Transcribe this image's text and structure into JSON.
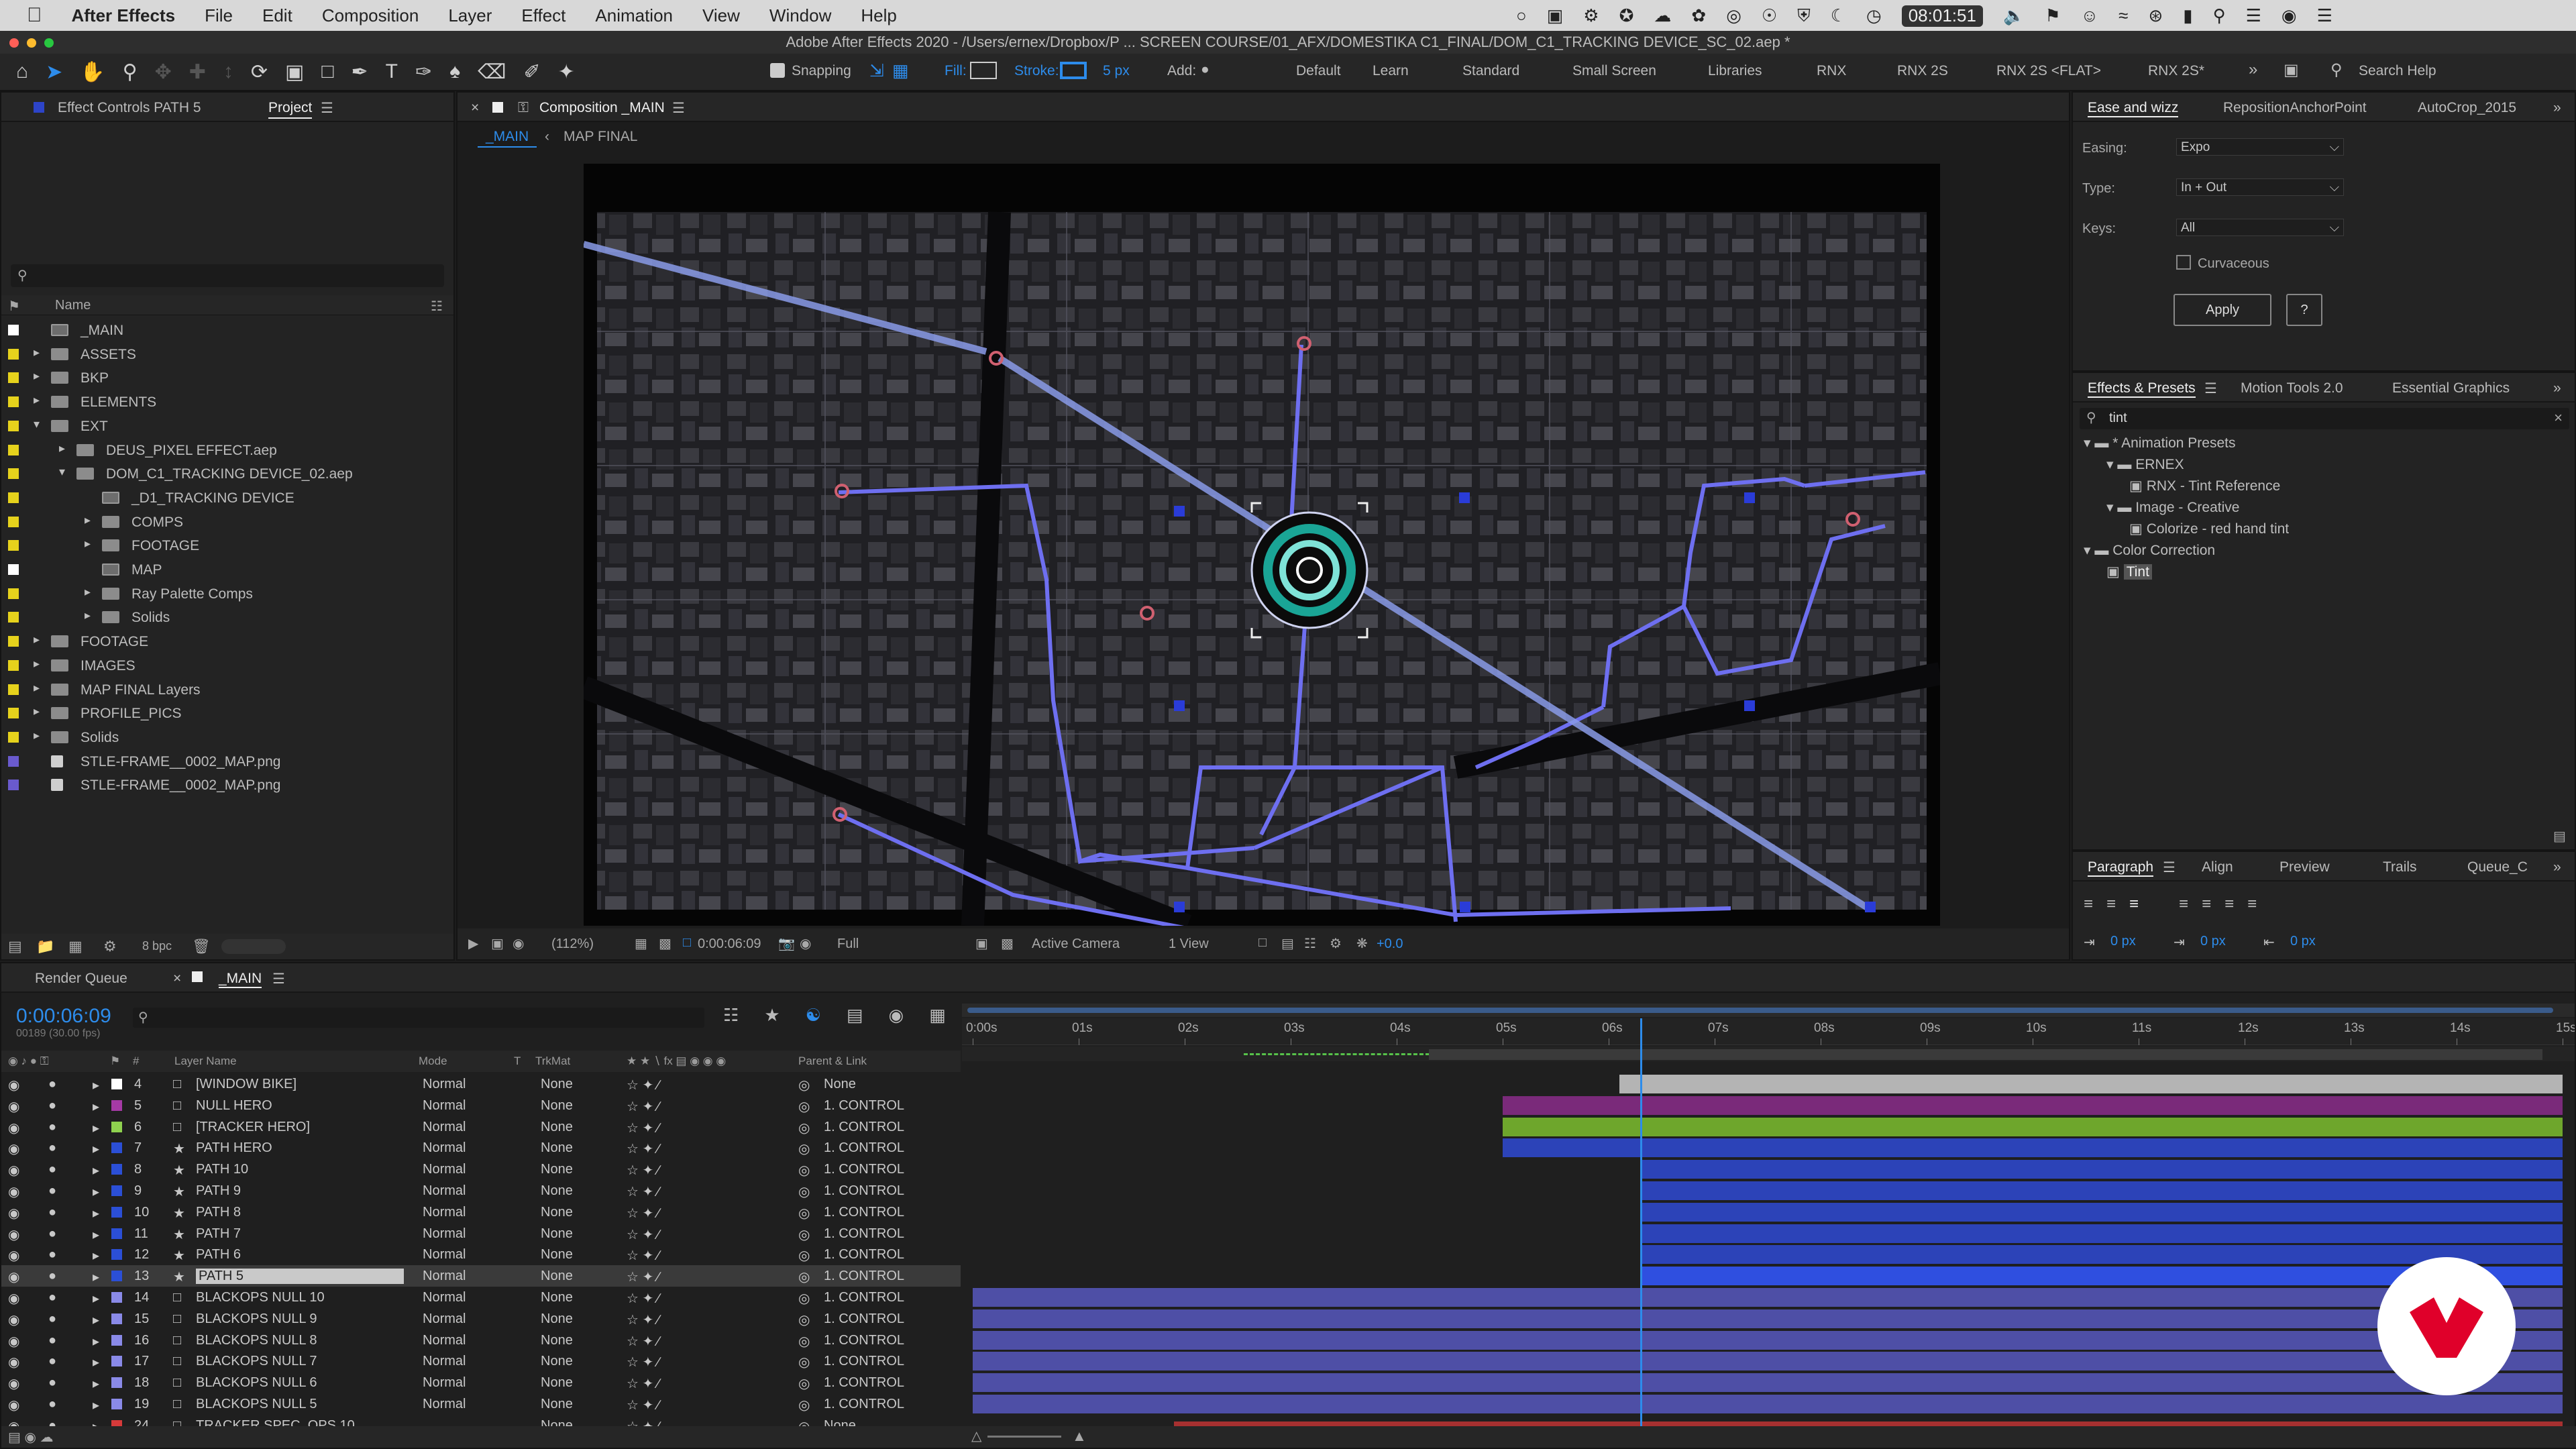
{
  "menubar": {
    "app": "After Effects",
    "items": [
      "File",
      "Edit",
      "Composition",
      "Layer",
      "Effect",
      "Animation",
      "View",
      "Window",
      "Help"
    ],
    "clock": "08:01:51"
  },
  "window": {
    "title": "Adobe After Effects 2020 - /Users/ernex/Dropbox/P ... SCREEN COURSE/01_AFX/DOMESTIKA C1_FINAL/DOM_C1_TRACKING DEVICE_SC_02.aep *"
  },
  "toolbar": {
    "snapping": "Snapping",
    "fill": "Fill:",
    "stroke": "Stroke:",
    "stroke_width": "5 px",
    "add": "Add:",
    "workspaces": [
      "Default",
      "Learn",
      "Standard",
      "Small Screen",
      "Libraries",
      "RNX",
      "RNX 2S",
      "RNX 2S <FLAT>",
      "RNX 2S*"
    ],
    "search": "Search Help"
  },
  "project": {
    "tab_effects": "Effect Controls PATH 5",
    "tab_project": "Project",
    "col_name": "Name",
    "bpc": "8 bpc",
    "items": [
      {
        "label": "_MAIN",
        "indent": 0,
        "kind": "comp",
        "color": "#ffffff"
      },
      {
        "label": "ASSETS",
        "indent": 0,
        "kind": "folder",
        "color": "#e6d21c"
      },
      {
        "label": "BKP",
        "indent": 0,
        "kind": "folder",
        "color": "#e6d21c"
      },
      {
        "label": "ELEMENTS",
        "indent": 0,
        "kind": "folder",
        "color": "#e6d21c"
      },
      {
        "label": "EXT",
        "indent": 0,
        "kind": "folder-open",
        "color": "#e6d21c"
      },
      {
        "label": "DEUS_PIXEL EFFECT.aep",
        "indent": 1,
        "kind": "folder",
        "color": "#e6d21c"
      },
      {
        "label": "DOM_C1_TRACKING DEVICE_02.aep",
        "indent": 1,
        "kind": "folder-open",
        "color": "#e6d21c"
      },
      {
        "label": "_D1_TRACKING DEVICE",
        "indent": 2,
        "kind": "comp",
        "color": "#e6d21c"
      },
      {
        "label": "COMPS",
        "indent": 2,
        "kind": "folder",
        "color": "#e6d21c"
      },
      {
        "label": "FOOTAGE",
        "indent": 2,
        "kind": "folder",
        "color": "#e6d21c"
      },
      {
        "label": "MAP",
        "indent": 2,
        "kind": "comp",
        "color": "#ffffff"
      },
      {
        "label": "Ray Palette Comps",
        "indent": 2,
        "kind": "folder",
        "color": "#e6d21c"
      },
      {
        "label": "Solids",
        "indent": 2,
        "kind": "folder",
        "color": "#e6d21c"
      },
      {
        "label": "FOOTAGE",
        "indent": 0,
        "kind": "folder",
        "color": "#e6d21c"
      },
      {
        "label": "IMAGES",
        "indent": 0,
        "kind": "folder",
        "color": "#e6d21c"
      },
      {
        "label": "MAP FINAL Layers",
        "indent": 0,
        "kind": "folder",
        "color": "#e6d21c"
      },
      {
        "label": "PROFILE_PICS",
        "indent": 0,
        "kind": "folder",
        "color": "#e6d21c"
      },
      {
        "label": "Solids",
        "indent": 0,
        "kind": "folder",
        "color": "#e6d21c"
      },
      {
        "label": "STLE-FRAME__0002_MAP.png",
        "indent": 0,
        "kind": "file",
        "color": "#6a5acd"
      },
      {
        "label": "STLE-FRAME__0002_MAP.png",
        "indent": 0,
        "kind": "file",
        "color": "#6a5acd"
      }
    ]
  },
  "composition": {
    "tab": "Composition _MAIN",
    "breadcrumbs": [
      "_MAIN",
      "MAP FINAL"
    ],
    "zoom": "(112%)",
    "timecode": "0:00:06:09",
    "resolution": "Full",
    "camera": "Active Camera",
    "views": "1 View",
    "exposure": "+0.0"
  },
  "ease": {
    "tabs": [
      "Ease and wizz",
      "RepositionAnchorPoint",
      "AutoCrop_2015"
    ],
    "easing_label": "Easing:",
    "easing": "Expo",
    "type_label": "Type:",
    "type": "In + Out",
    "keys_label": "Keys:",
    "keys": "All",
    "curvaceous": "Curvaceous",
    "apply": "Apply",
    "help": "?"
  },
  "effects": {
    "tabs": [
      "Effects & Presets",
      "Motion Tools 2.0",
      "Essential Graphics"
    ],
    "search": "tint",
    "tree": [
      {
        "label": "* Animation Presets",
        "indent": 0
      },
      {
        "label": "ERNEX",
        "indent": 1
      },
      {
        "label": "RNX - Tint Reference",
        "indent": 2
      },
      {
        "label": "Image - Creative",
        "indent": 1
      },
      {
        "label": "Colorize - red hand tint",
        "indent": 2
      },
      {
        "label": "Color Correction",
        "indent": 0
      },
      {
        "label": "Tint",
        "indent": 1
      }
    ]
  },
  "paragraph": {
    "tabs": [
      "Paragraph",
      "Align",
      "Preview",
      "Trails",
      "Queue_C"
    ],
    "indents": [
      "0 px",
      "0 px",
      "0 px"
    ]
  },
  "timeline": {
    "tab_render": "Render Queue",
    "tab_main": "_MAIN",
    "timecode": "0:00:06:09",
    "frames": "00189 (30.00 fps)",
    "columns": {
      "num": "#",
      "name": "Layer Name",
      "mode": "Mode",
      "t": "T",
      "trkmat": "TrkMat",
      "parent": "Parent & Link"
    },
    "ruler": [
      "0:00s",
      "01s",
      "02s",
      "03s",
      "04s",
      "05s",
      "06s",
      "07s",
      "08s",
      "09s",
      "10s",
      "11s",
      "12s",
      "13s",
      "14s",
      "15s"
    ],
    "layers": [
      {
        "num": "4",
        "name": "[WINDOW BIKE]",
        "color": "#ffffff",
        "mode": "Normal",
        "trk": "None",
        "parent": "None",
        "bar_color": "#b4b4b4",
        "bar_start": 6.1,
        "bar_end": 15
      },
      {
        "num": "5",
        "name": "NULL HERO",
        "color": "#a63aa6",
        "mode": "Normal",
        "trk": "None",
        "parent": "1. CONTROL",
        "bar_color": "#7a2a7a",
        "bar_start": 5.0,
        "bar_end": 15
      },
      {
        "num": "6",
        "name": "[TRACKER HERO]",
        "color": "#8fd14f",
        "mode": "Normal",
        "trk": "None",
        "parent": "1. CONTROL",
        "bar_color": "#6ea62c",
        "bar_start": 5.0,
        "bar_end": 15
      },
      {
        "num": "7",
        "name": "PATH HERO",
        "color": "#2b4fd6",
        "mode": "Normal",
        "trk": "None",
        "parent": "1. CONTROL",
        "bar_color": "#2c43b8",
        "bar_start": 5.0,
        "bar_end": 15
      },
      {
        "num": "8",
        "name": "PATH 10",
        "color": "#2b4fd6",
        "mode": "Normal",
        "trk": "None",
        "parent": "1. CONTROL",
        "bar_color": "#2c43b8",
        "bar_start": 6.3,
        "bar_end": 15
      },
      {
        "num": "9",
        "name": "PATH 9",
        "color": "#2b4fd6",
        "mode": "Normal",
        "trk": "None",
        "parent": "1. CONTROL",
        "bar_color": "#2c43b8",
        "bar_start": 6.3,
        "bar_end": 15
      },
      {
        "num": "10",
        "name": "PATH 8",
        "color": "#2b4fd6",
        "mode": "Normal",
        "trk": "None",
        "parent": "1. CONTROL",
        "bar_color": "#2c43b8",
        "bar_start": 6.3,
        "bar_end": 15
      },
      {
        "num": "11",
        "name": "PATH 7",
        "color": "#2b4fd6",
        "mode": "Normal",
        "trk": "None",
        "parent": "1. CONTROL",
        "bar_color": "#2c43b8",
        "bar_start": 6.3,
        "bar_end": 15
      },
      {
        "num": "12",
        "name": "PATH 6",
        "color": "#2b4fd6",
        "mode": "Normal",
        "trk": "None",
        "parent": "1. CONTROL",
        "bar_color": "#2c43b8",
        "bar_start": 6.3,
        "bar_end": 15
      },
      {
        "num": "13",
        "name": "PATH 5",
        "color": "#2b4fd6",
        "mode": "Normal",
        "trk": "None",
        "parent": "1. CONTROL",
        "bar_color": "#2f4fe0",
        "bar_start": 6.3,
        "bar_end": 15,
        "selected": true
      },
      {
        "num": "14",
        "name": "BLACKOPS NULL 10",
        "color": "#8a8ae8",
        "mode": "Normal",
        "trk": "None",
        "parent": "1. CONTROL",
        "bar_color": "#4e4fa6",
        "bar_start": 0.0,
        "bar_end": 15
      },
      {
        "num": "15",
        "name": "BLACKOPS NULL 9",
        "color": "#8a8ae8",
        "mode": "Normal",
        "trk": "None",
        "parent": "1. CONTROL",
        "bar_color": "#4e4fa6",
        "bar_start": 0.0,
        "bar_end": 15
      },
      {
        "num": "16",
        "name": "BLACKOPS NULL 8",
        "color": "#8a8ae8",
        "mode": "Normal",
        "trk": "None",
        "parent": "1. CONTROL",
        "bar_color": "#4e4fa6",
        "bar_start": 0.0,
        "bar_end": 15
      },
      {
        "num": "17",
        "name": "BLACKOPS NULL 7",
        "color": "#8a8ae8",
        "mode": "Normal",
        "trk": "None",
        "parent": "1. CONTROL",
        "bar_color": "#4e4fa6",
        "bar_start": 0.0,
        "bar_end": 15
      },
      {
        "num": "18",
        "name": "BLACKOPS NULL 6",
        "color": "#8a8ae8",
        "mode": "Normal",
        "trk": "None",
        "parent": "1. CONTROL",
        "bar_color": "#4e4fa6",
        "bar_start": 0.0,
        "bar_end": 15
      },
      {
        "num": "19",
        "name": "BLACKOPS NULL 5",
        "color": "#8a8ae8",
        "mode": "Normal",
        "trk": "None",
        "parent": "1. CONTROL",
        "bar_color": "#4e4fa6",
        "bar_start": 0.0,
        "bar_end": 15
      },
      {
        "num": "24",
        "name": "TRACKER SPEC_OPS 10",
        "color": "#d63a3a",
        "mode": "",
        "trk": "None",
        "parent": "None",
        "bar_color": "#a63030",
        "bar_start": 1.9,
        "bar_end": 15
      }
    ],
    "playhead_seconds": 6.3,
    "duration_seconds": 15
  },
  "colors": {
    "accent": "#2d8ceb",
    "brand": "#e0002a"
  },
  "icons": [
    "apple-icon",
    "home-icon",
    "selection-tool-icon",
    "hand-tool-icon",
    "zoom-tool-icon",
    "search-icon",
    "wifi-icon",
    "volume-icon",
    "eye-icon",
    "brand-logo"
  ]
}
